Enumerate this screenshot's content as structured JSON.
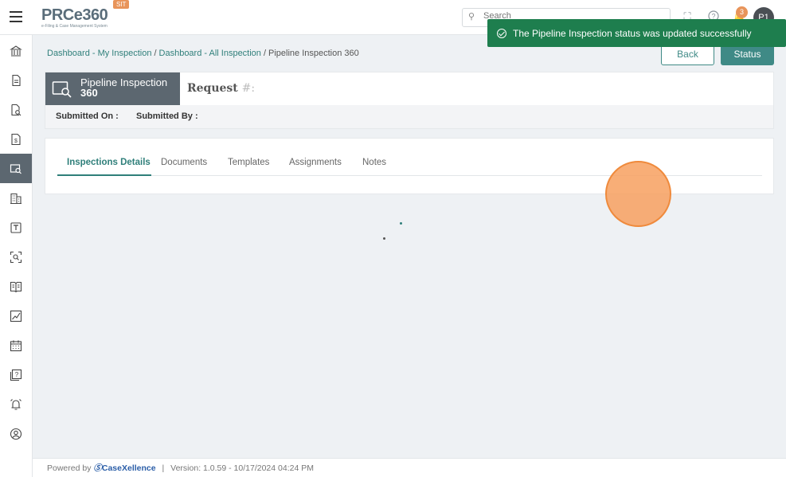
{
  "header": {
    "logo_text": "PRCe360",
    "logo_subtext": "e-Filing & Case Management System",
    "env_badge": "SIT",
    "search_placeholder": "Search",
    "notification_count": "3",
    "avatar_initials": "P1"
  },
  "toast": {
    "message": "The Pipeline Inspection status was updated successfully"
  },
  "breadcrumb": {
    "items": [
      "Dashboard - My Inspection",
      "Dashboard - All Inspection"
    ],
    "current": "Pipeline Inspection 360"
  },
  "actions": {
    "back_label": "Back",
    "status_label": "Status"
  },
  "record": {
    "title_line1": "Pipeline Inspection",
    "title_line2": "360",
    "request_label": "Request",
    "request_hash": "#:",
    "submitted_on_label": "Submitted On :",
    "submitted_by_label": "Submitted By :"
  },
  "tabs": [
    {
      "label": "Inspections Details",
      "active": true
    },
    {
      "label": "Documents",
      "active": false
    },
    {
      "label": "Templates",
      "active": false
    },
    {
      "label": "Assignments",
      "active": false
    },
    {
      "label": "Notes",
      "active": false
    }
  ],
  "footer": {
    "powered_by": "Powered by",
    "brand": "CaseXellence",
    "separator": "|",
    "version": "Version: 1.0.59 - 10/17/2024 04:24 PM"
  },
  "sidebar": {
    "items": [
      {
        "icon": "bank-icon"
      },
      {
        "icon": "document-icon"
      },
      {
        "icon": "document-search-icon"
      },
      {
        "icon": "invoice-icon"
      },
      {
        "icon": "inspection-icon",
        "active": true
      },
      {
        "icon": "building-icon"
      },
      {
        "icon": "template-icon"
      },
      {
        "icon": "scan-icon"
      },
      {
        "icon": "book-icon"
      },
      {
        "icon": "chart-icon"
      },
      {
        "icon": "calendar-icon"
      },
      {
        "icon": "help-doc-icon"
      },
      {
        "icon": "alarm-icon"
      },
      {
        "icon": "user-circle-icon"
      }
    ]
  },
  "colors": {
    "accent": "#3f8a86",
    "toast_bg": "#1e7e4e",
    "sidebar_active": "#5c6770",
    "badge": "#e8945a"
  }
}
